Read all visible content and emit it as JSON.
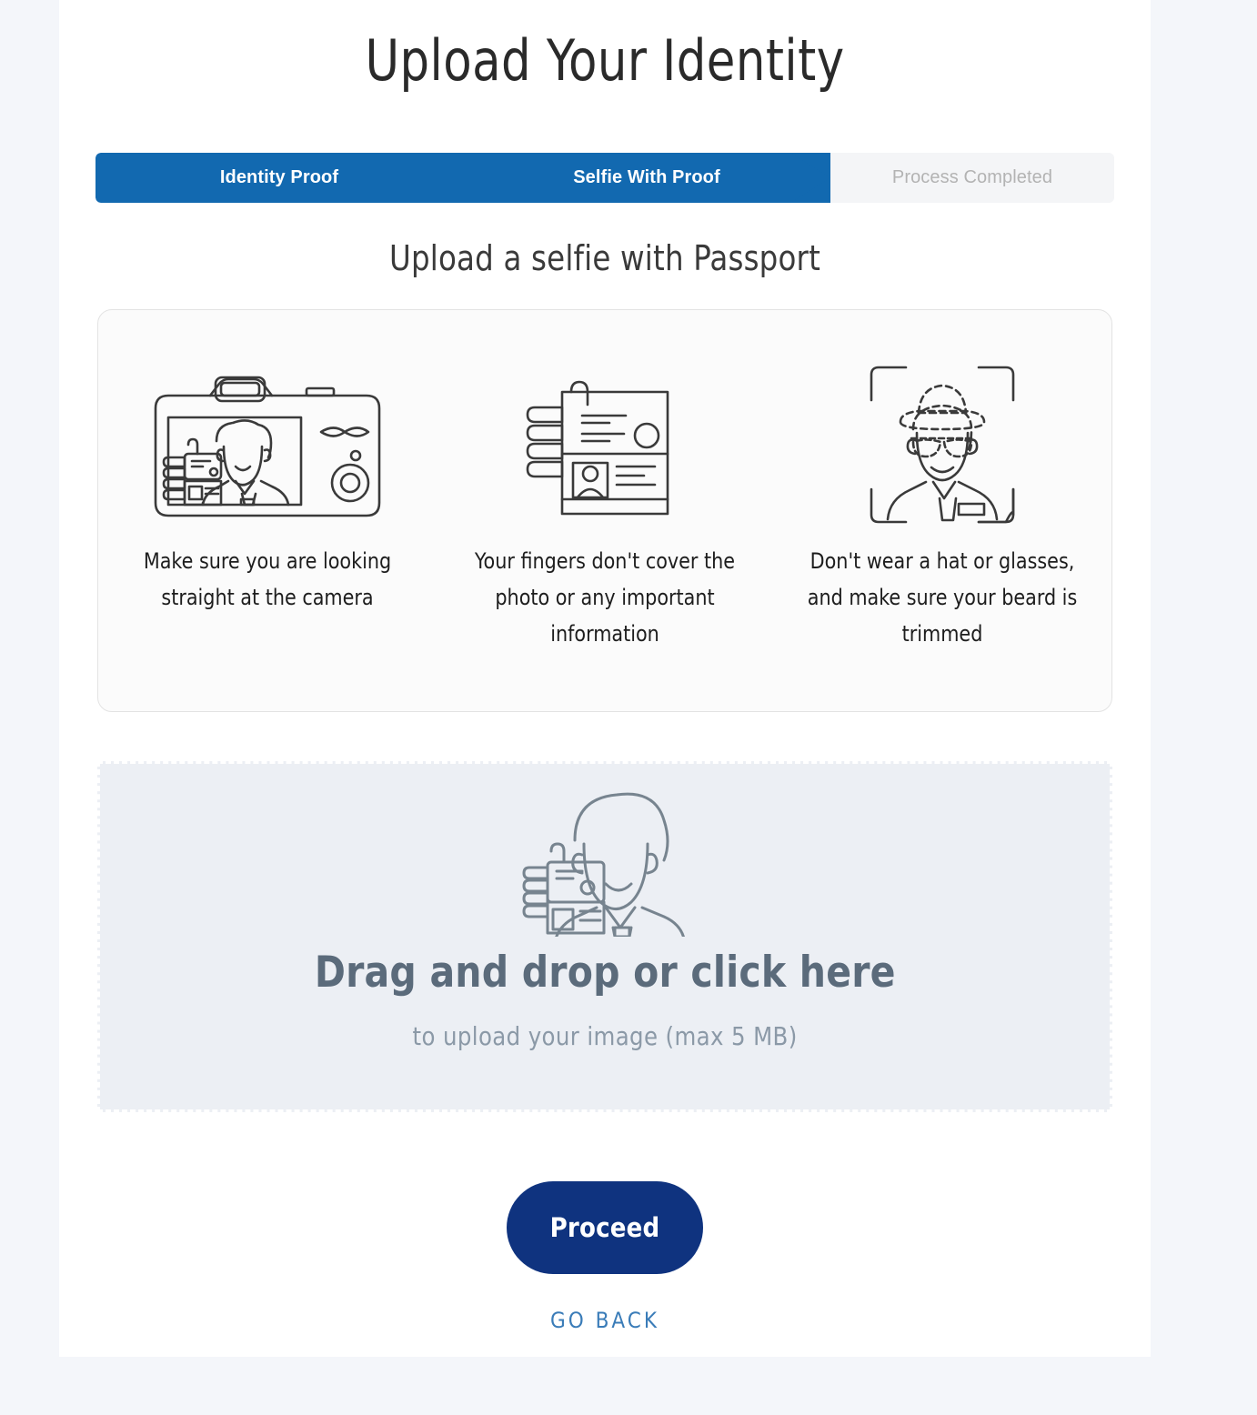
{
  "page": {
    "title": "Upload Your Identity",
    "sub_heading": "Upload a selfie with Passport"
  },
  "stepper": {
    "steps": [
      {
        "label": "Identity Proof",
        "state": "completed"
      },
      {
        "label": "Selfie With Proof",
        "state": "active"
      },
      {
        "label": "Process Completed",
        "state": "pending"
      }
    ],
    "active_color": "#1269b0",
    "inactive_bg": "#f4f5f7",
    "inactive_text_color": "#b3b3b3"
  },
  "tips": [
    {
      "icon": "camera-selfie-icon",
      "text": "Make sure you are looking straight at the camera"
    },
    {
      "icon": "hand-holding-id-card-icon",
      "text": "Your fingers don't cover the photo or any important information"
    },
    {
      "icon": "face-scan-no-hat-glasses-icon",
      "text": "Don't wear a hat or glasses, and make sure your beard is trimmed"
    }
  ],
  "dropzone": {
    "icon": "person-holding-id-icon",
    "title": "Drag and drop or click here",
    "subtitle": "to upload your image (max 5 MB)",
    "background": "#eceff4",
    "title_color": "#5b6b7b",
    "subtitle_color": "#8b99a7"
  },
  "actions": {
    "proceed_label": "Proceed",
    "proceed_color": "#0f337f",
    "go_back_label": "GO BACK",
    "go_back_color": "#3a7cb8"
  }
}
